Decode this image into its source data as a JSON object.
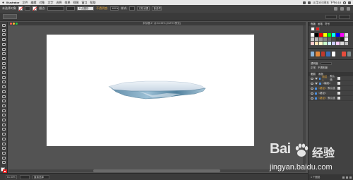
{
  "menubar": {
    "app_name": "Illustrator",
    "items": [
      "文件",
      "编辑",
      "对象",
      "文字",
      "选择",
      "效果",
      "视图",
      "窗口",
      "帮助"
    ],
    "clock": "11月3日 周五 下午6:18"
  },
  "control_bar": {
    "selection_label": "未选择对象",
    "stroke_label": "描边:",
    "style_label": "5 点圆形",
    "opacity_label": "不透明度:",
    "opacity_value": "100%",
    "style2_label": "样式:",
    "doc_setup_label": "文档设置",
    "prefs_label": "首选项"
  },
  "document": {
    "title": "未标题-1* @ 61.53% (CMYK/预览)",
    "dot_colors": [
      "#ff5f57",
      "#febc2e",
      "#28c840"
    ]
  },
  "toolbar": {
    "tools": [
      "selection-tool",
      "direct-selection-tool",
      "magic-wand-tool",
      "lasso-tool",
      "pen-tool",
      "curvature-tool",
      "type-tool",
      "line-tool",
      "rectangle-tool",
      "paintbrush-tool",
      "shaper-tool",
      "pencil-tool",
      "eraser-tool",
      "rotate-tool",
      "scale-tool",
      "width-tool",
      "warp-tool",
      "free-transform-tool",
      "shape-builder-tool",
      "perspective-grid-tool",
      "mesh-tool",
      "gradient-tool",
      "eyedropper-tool",
      "blend-tool",
      "symbol-sprayer-tool",
      "column-graph-tool",
      "artboard-tool",
      "slice-tool",
      "hand-tool",
      "zoom-tool"
    ],
    "fill_color": "#ffffff",
    "stroke_color": "#e02020"
  },
  "status": {
    "zoom": "61.53%",
    "page": "1",
    "tool_name": "直接选择"
  },
  "panels": {
    "swatch_tab": "色板",
    "swatch_tab2": "画笔",
    "swatch_tab3": "符号",
    "swatch_colors": [
      "#ffffff",
      "#000000",
      "#ff0000",
      "#ffff00",
      "#00ff00",
      "#00ffff",
      "#0000ff",
      "#ff00ff",
      "#e0e0e0",
      "#cccccc",
      "#b3b3b3",
      "#999999",
      "#808080",
      "#666666",
      "#4d4d4d",
      "#333333",
      "#1a1a1a",
      "#f2f2f2",
      "#ffcccc",
      "#ffe0b3",
      "#ffffcc",
      "#ccffcc",
      "#cceeff",
      "#ccccff",
      "#ffccff",
      "#d9d9d9",
      "#bfbfbf"
    ],
    "graphic_styles": [
      "#8bb4d9",
      "#e48a3c",
      "#c0392b",
      "#3b6fb5",
      "#ffffff",
      "#444444",
      "#e74c3c",
      "#7f8c8d"
    ],
    "transparency_label": "透明度",
    "blend_mode": "正常",
    "opacity_label": "不透明度",
    "layers_tab": "图层",
    "artboards_tab": "画板",
    "layers": [
      {
        "name": "图层 1",
        "extra": "默认值",
        "highlight": true
      },
      {
        "name": "<编组>",
        "extra": "",
        "highlight": false
      },
      {
        "name": "<路径>",
        "extra": "默认值",
        "highlight": true
      },
      {
        "name": "<路径>",
        "extra": "",
        "highlight": false
      },
      {
        "name": "<路径>",
        "extra": "默认值",
        "highlight": true
      }
    ],
    "layers_footer": "1 个图层"
  },
  "watermark": {
    "brand": "Bai",
    "brand2": "经验",
    "url": "jingyan.baidu.com"
  }
}
